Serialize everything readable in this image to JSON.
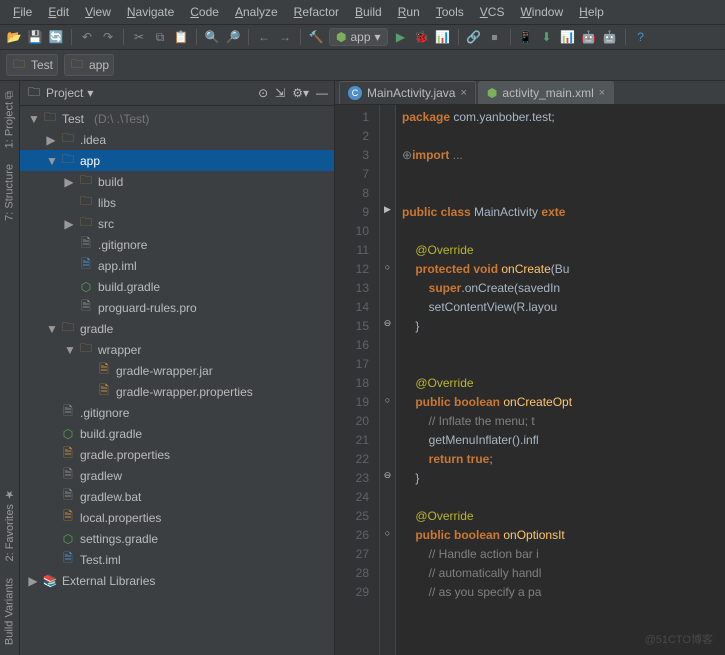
{
  "menu": [
    "File",
    "Edit",
    "View",
    "Navigate",
    "Code",
    "Analyze",
    "Refactor",
    "Build",
    "Run",
    "Tools",
    "VCS",
    "Window",
    "Help"
  ],
  "run_config": {
    "module": "app"
  },
  "breadcrumb": [
    "Test",
    "app"
  ],
  "project": {
    "label": "Project",
    "root": {
      "name": "Test",
      "path": "(D:\\                                .\\Test)"
    },
    "tree": [
      {
        "d": 0,
        "t": "root",
        "open": true,
        "kind": "folder",
        "text": "Test",
        "hint": "(D:\\                                .\\Test)"
      },
      {
        "d": 1,
        "t": "node",
        "open": false,
        "kind": "folder",
        "text": ".idea"
      },
      {
        "d": 1,
        "t": "node",
        "open": true,
        "kind": "folder",
        "text": "app",
        "sel": true
      },
      {
        "d": 2,
        "t": "node",
        "open": false,
        "kind": "folder",
        "text": "build"
      },
      {
        "d": 2,
        "t": "leaf",
        "kind": "folder",
        "text": "libs"
      },
      {
        "d": 2,
        "t": "node",
        "open": false,
        "kind": "folder",
        "text": "src"
      },
      {
        "d": 2,
        "t": "leaf",
        "kind": "file",
        "text": ".gitignore"
      },
      {
        "d": 2,
        "t": "leaf",
        "kind": "java",
        "text": "app.iml"
      },
      {
        "d": 2,
        "t": "leaf",
        "kind": "gradle",
        "text": "build.gradle"
      },
      {
        "d": 2,
        "t": "leaf",
        "kind": "file",
        "text": "proguard-rules.pro"
      },
      {
        "d": 1,
        "t": "node",
        "open": true,
        "kind": "folder",
        "text": "gradle"
      },
      {
        "d": 2,
        "t": "node",
        "open": true,
        "kind": "folder",
        "text": "wrapper"
      },
      {
        "d": 3,
        "t": "leaf",
        "kind": "jar",
        "text": "gradle-wrapper.jar"
      },
      {
        "d": 3,
        "t": "leaf",
        "kind": "props",
        "text": "gradle-wrapper.properties"
      },
      {
        "d": 1,
        "t": "leaf",
        "kind": "file",
        "text": ".gitignore"
      },
      {
        "d": 1,
        "t": "leaf",
        "kind": "gradle",
        "text": "build.gradle"
      },
      {
        "d": 1,
        "t": "leaf",
        "kind": "props",
        "text": "gradle.properties"
      },
      {
        "d": 1,
        "t": "leaf",
        "kind": "file",
        "text": "gradlew"
      },
      {
        "d": 1,
        "t": "leaf",
        "kind": "file",
        "text": "gradlew.bat"
      },
      {
        "d": 1,
        "t": "leaf",
        "kind": "props",
        "text": "local.properties"
      },
      {
        "d": 1,
        "t": "leaf",
        "kind": "gradle",
        "text": "settings.gradle"
      },
      {
        "d": 1,
        "t": "leaf",
        "kind": "java",
        "text": "Test.iml"
      },
      {
        "d": 0,
        "t": "node",
        "open": false,
        "kind": "lib",
        "text": "External Libraries"
      }
    ]
  },
  "tabs": [
    {
      "icon": "class",
      "name": "MainActivity.java",
      "active": true
    },
    {
      "icon": "xml",
      "name": "activity_main.xml",
      "active": false
    }
  ],
  "code": {
    "lines": [
      1,
      2,
      3,
      7,
      8,
      9,
      10,
      11,
      12,
      13,
      14,
      15,
      16,
      17,
      18,
      19,
      20,
      21,
      22,
      23,
      24,
      25,
      26,
      27,
      28,
      29
    ],
    "text": [
      {
        "html": "<span class=kw>package</span> com.yanbober.test;"
      },
      {
        "html": ""
      },
      {
        "html": "<span class=cm>⊕</span><span class=kw>import</span> <span class=cm>...</span>"
      },
      {
        "html": ""
      },
      {
        "html": ""
      },
      {
        "html": "<span class=kw>public class</span> MainActivity <span class=kw>exte</span>"
      },
      {
        "html": ""
      },
      {
        "html": "    <span class=ann>@Override</span>"
      },
      {
        "html": "    <span class=kw>protected void</span> <span class=fn>onCreate</span>(Bu"
      },
      {
        "html": "        <span class=kw>super</span>.onCreate(savedIn"
      },
      {
        "html": "        setContentView(R.layou"
      },
      {
        "html": "    }"
      },
      {
        "html": ""
      },
      {
        "html": ""
      },
      {
        "html": "    <span class=ann>@Override</span>"
      },
      {
        "html": "    <span class=kw>public boolean</span> <span class=fn>onCreateOpt</span>"
      },
      {
        "html": "        <span class=cm>// Inflate the menu; t</span>"
      },
      {
        "html": "        getMenuInflater().infl"
      },
      {
        "html": "        <span class=kw>return true</span>;"
      },
      {
        "html": "    }"
      },
      {
        "html": ""
      },
      {
        "html": "    <span class=ann>@Override</span>"
      },
      {
        "html": "    <span class=kw>public boolean</span> <span class=fn>onOptionsIt</span>"
      },
      {
        "html": "        <span class=cm>// Handle action bar i</span>"
      },
      {
        "html": "        <span class=cm>// automatically handl</span>"
      },
      {
        "html": "        <span class=cm>// as you specify a pa</span>"
      }
    ],
    "marks": {
      "9": "▶",
      "12": "○",
      "15": "⊖",
      "19": "○",
      "23": "⊖",
      "26": "○"
    }
  },
  "watermark": "@51CTO博客"
}
